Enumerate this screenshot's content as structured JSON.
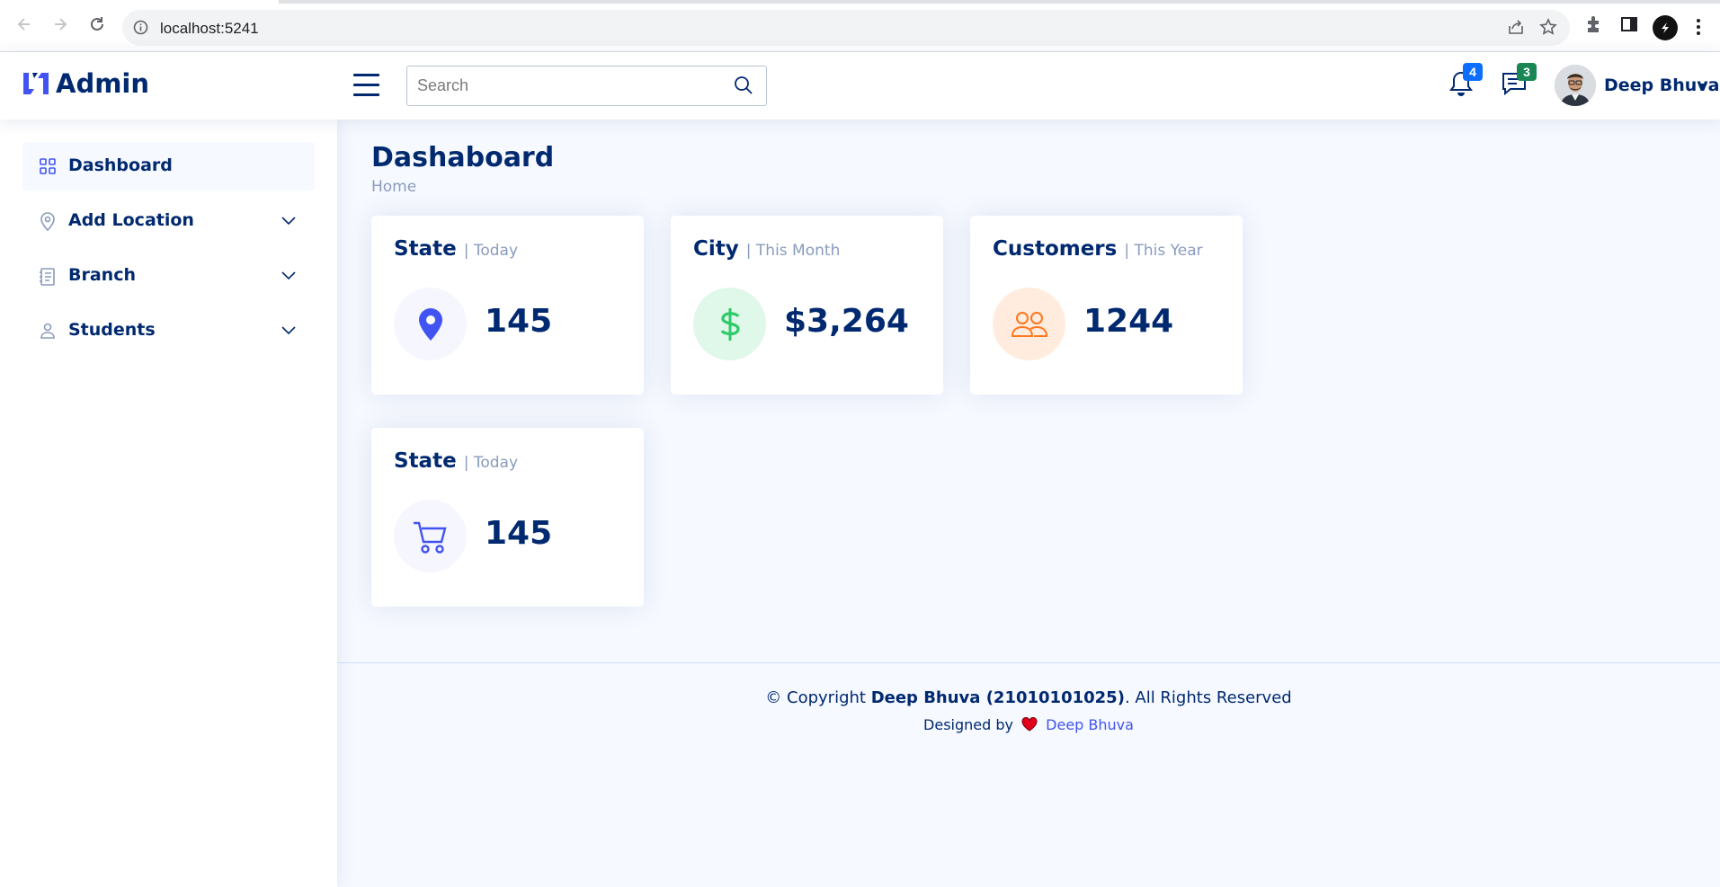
{
  "browser": {
    "url": "localhost:5241",
    "icons": [
      "back-icon",
      "forward-icon",
      "reload-icon",
      "info-icon",
      "share-icon",
      "star-icon",
      "extensions-icon",
      "side-panel-icon",
      "profile-icon",
      "menu-kebab-icon"
    ]
  },
  "header": {
    "brand": "Admin",
    "search_placeholder": "Search",
    "notifications_count": "4",
    "messages_count": "3",
    "user_name": "Deep Bhuva"
  },
  "sidebar": {
    "items": [
      {
        "label": "Dashboard",
        "icon": "grid-icon",
        "active": true
      },
      {
        "label": "Add Location",
        "icon": "location-pin-icon",
        "active": false
      },
      {
        "label": "Branch",
        "icon": "journal-icon",
        "active": false
      },
      {
        "label": "Students",
        "icon": "person-icon",
        "active": false
      }
    ]
  },
  "main": {
    "title": "Dashaboard",
    "breadcrumb": "Home",
    "cards": [
      {
        "title": "State",
        "period": "| Today",
        "value": "145",
        "icon": "geo-pin-icon"
      },
      {
        "title": "City",
        "period": "| This Month",
        "value": "$3,264",
        "icon": "dollar-icon"
      },
      {
        "title": "Customers",
        "period": "| This Year",
        "value": "1244",
        "icon": "people-icon"
      },
      {
        "title": "State",
        "period": "| Today",
        "value": "145",
        "icon": "cart-icon"
      }
    ]
  },
  "footer": {
    "copyright_prefix": "© Copyright ",
    "copyright_name": "Deep Bhuva (21010101025)",
    "copyright_suffix": ". All Rights Reserved",
    "designed_by": "Designed by",
    "designer": "Deep Bhuva"
  },
  "colors": {
    "primary": "#012970",
    "accent": "#4154f1",
    "muted": "#899bbd",
    "background": "#f6f9ff",
    "green": "#2eca6a",
    "orange": "#ff771d"
  }
}
